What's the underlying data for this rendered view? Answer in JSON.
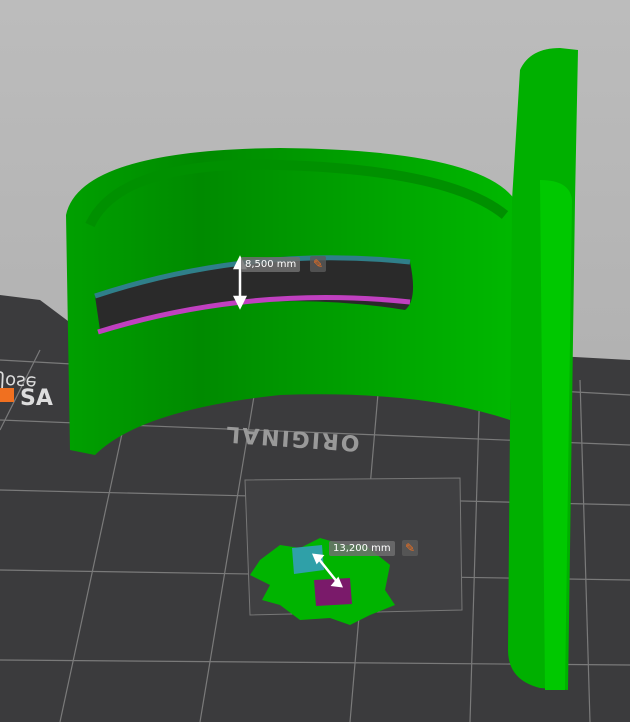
{
  "viewport": {
    "bed_text": {
      "logo_left": "SA",
      "logo_accent": "█",
      "author": "Jose",
      "model": "ORIGINAL"
    },
    "measurements": [
      {
        "value": "8,500 mm",
        "edit_icon": "pencil-icon"
      },
      {
        "value": "13,200 mm",
        "edit_icon": "pencil-icon"
      }
    ]
  },
  "colors": {
    "model": "#00b400",
    "bed": "#3c3c3e",
    "background_top": "#b8b8b8",
    "feature_a": "#2f9fa8",
    "feature_b": "#c040c0",
    "accent": "#f07020"
  }
}
